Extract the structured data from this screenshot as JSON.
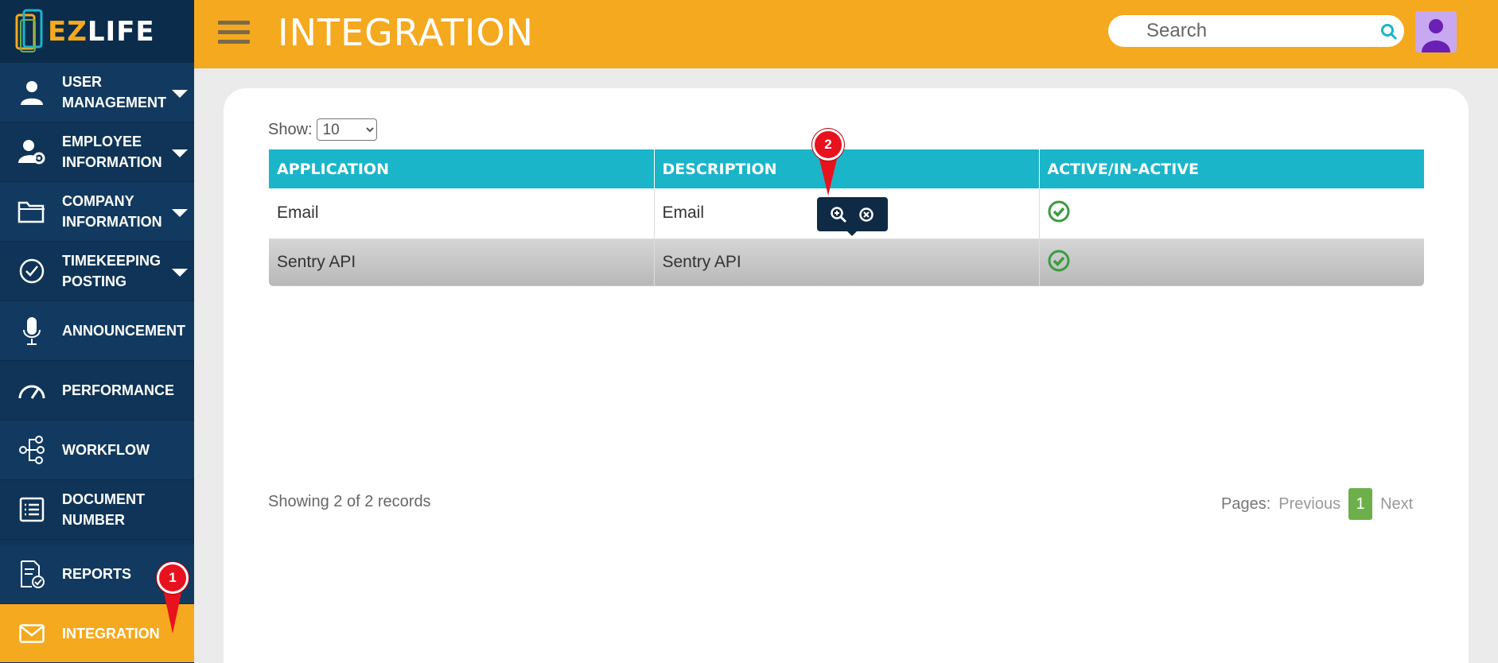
{
  "app": {
    "logo_prefix": "EZ",
    "logo_suffix": "LIFE"
  },
  "sidebar": {
    "items": [
      {
        "label": "USER\nMANAGEMENT",
        "icon": "user-icon",
        "has_caret": true
      },
      {
        "label": "EMPLOYEE\nINFORMATION",
        "icon": "employee-gear-icon",
        "has_caret": true
      },
      {
        "label": "COMPANY\nINFORMATION",
        "icon": "folder-icon",
        "has_caret": true
      },
      {
        "label": "TIMEKEEPING\nPOSTING",
        "icon": "check-circle-icon",
        "has_caret": true
      },
      {
        "label": "ANNOUNCEMENT",
        "icon": "microphone-icon",
        "has_caret": false
      },
      {
        "label": "PERFORMANCE",
        "icon": "gauge-icon",
        "has_caret": false
      },
      {
        "label": "WORKFLOW",
        "icon": "workflow-icon",
        "has_caret": false
      },
      {
        "label": "DOCUMENT\nNUMBER",
        "icon": "document-list-icon",
        "has_caret": false
      },
      {
        "label": "REPORTS",
        "icon": "report-icon",
        "has_caret": false
      },
      {
        "label": "INTEGRATION",
        "icon": "envelope-icon",
        "has_caret": false,
        "active": true
      }
    ]
  },
  "header": {
    "title": "INTEGRATION",
    "search_placeholder": "Search"
  },
  "content": {
    "show_label": "Show:",
    "page_size": "10",
    "columns": [
      "APPLICATION",
      "DESCRIPTION",
      "ACTIVE/IN-ACTIVE"
    ],
    "rows": [
      {
        "application": "Email",
        "description": "Email",
        "active": true
      },
      {
        "application": "Sentry API",
        "description": "Sentry API",
        "active": true
      }
    ],
    "row_tools": [
      "zoom-in-icon",
      "close-circle-icon"
    ],
    "showing_text": "Showing 2 of 2 records",
    "pager": {
      "label": "Pages:",
      "previous": "Previous",
      "current": "1",
      "next": "Next"
    }
  },
  "markers": [
    {
      "number": "1"
    },
    {
      "number": "2"
    }
  ],
  "colors": {
    "sidebar": "#0f3457",
    "accent": "#f5a91e",
    "table_header": "#1bb5c9",
    "active_check": "#3a9b3f",
    "marker": "#e8121e"
  }
}
